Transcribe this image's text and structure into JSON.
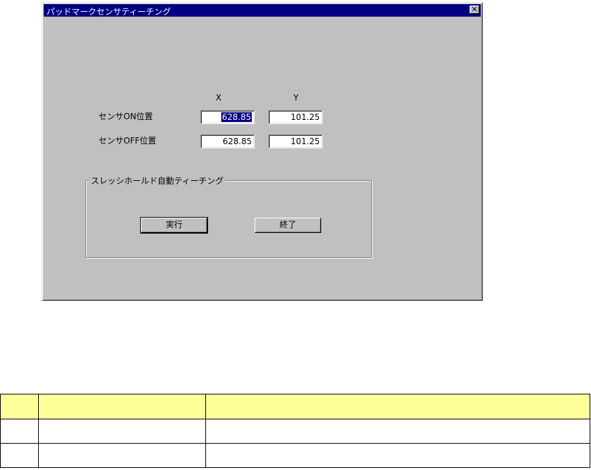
{
  "window": {
    "title": "パッドマークセンサティーチング",
    "close_glyph": "✕"
  },
  "form": {
    "col_x": "X",
    "col_y": "Y",
    "rows": [
      {
        "label": "センサON位置",
        "x": "628.85",
        "y": "101.25"
      },
      {
        "label": "センサOFF位置",
        "x": "628.85",
        "y": "101.25"
      }
    ]
  },
  "group": {
    "title": "スレッシホールド自動ティーチング",
    "run_label": "実行",
    "exit_label": "終了"
  },
  "legend_table": {
    "headers": [
      "",
      "",
      ""
    ],
    "rows": [
      [
        "",
        "",
        ""
      ],
      [
        "",
        "",
        ""
      ]
    ]
  }
}
